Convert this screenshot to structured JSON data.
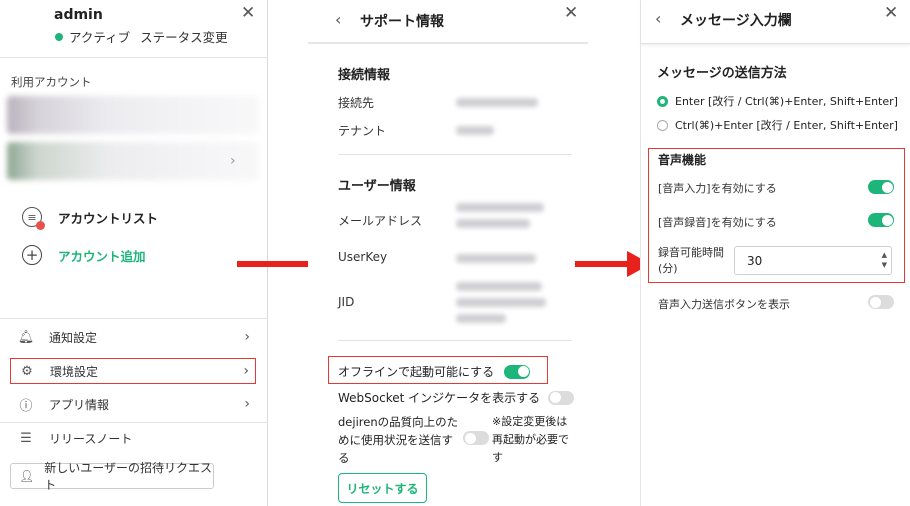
{
  "panel1": {
    "username": "admin",
    "status": "アクティブ",
    "status_change": "ステータス変更",
    "section_label": "利用アカウント",
    "account_list": "アカウントリスト",
    "add_account": "アカウント追加",
    "menu": {
      "notification": "通知設定",
      "environment": "環境設定",
      "app_info": "アプリ情報",
      "release_notes": "リリースノート",
      "invite": "新しいユーザーの招待リクエスト"
    }
  },
  "panel2": {
    "title": "サポート情報",
    "connection_heading": "接続情報",
    "connection_to": "接続先",
    "tenant": "テナント",
    "user_heading": "ユーザー情報",
    "email": "メールアドレス",
    "userkey": "UserKey",
    "jid": "JID",
    "offline_start": "オフラインで起動可能にする",
    "websocket_indicator": "WebSocket インジケータを表示する",
    "quality_text": "dejirenの品質向上のために使用状況を送信する",
    "restart_note": "※設定変更後は再起動が必要です",
    "reset_button": "リセットする",
    "toggles": {
      "offline": true,
      "websocket": false,
      "quality": false
    }
  },
  "panel3": {
    "title": "メッセージ入力欄",
    "send_method_heading": "メッセージの送信方法",
    "option_enter": "Enter [改行 / Ctrl(⌘)+Enter, Shift+Enter]",
    "option_ctrl_enter": "Ctrl(⌘)+Enter [改行 / Enter, Shift+Enter]",
    "selected_option": "enter",
    "voice_heading": "音声機能",
    "enable_voice_input": "[音声入力]を有効にする",
    "enable_voice_recording": "[音声録音]を有効にする",
    "recording_time_label": "録音可能時間(分)",
    "recording_time_value": "30",
    "show_voice_send_button": "音声入力送信ボタンを表示",
    "toggles": {
      "voice_input": true,
      "voice_recording": true,
      "voice_send_button": false
    }
  },
  "colors": {
    "accent": "#1eb57a",
    "highlight": "#e53935",
    "arrow": "#e8211c"
  },
  "icons": [
    "close-icon",
    "back-chevron-icon",
    "chevron-right-icon",
    "bell-icon",
    "gear-icon",
    "info-icon",
    "list-icon",
    "user-plus-icon",
    "plus-circle-icon",
    "account-list-icon"
  ]
}
